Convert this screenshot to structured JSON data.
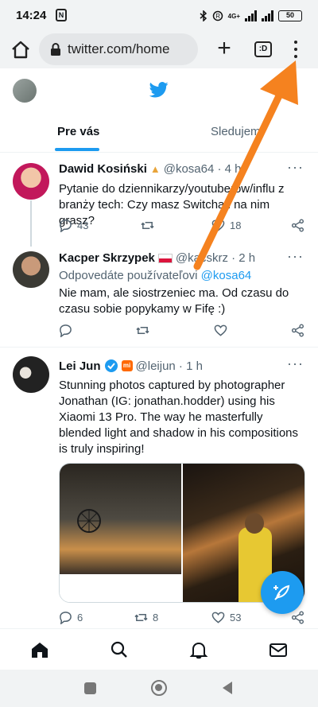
{
  "status_bar": {
    "time": "14:24",
    "network": "4G+",
    "battery": "50"
  },
  "browser": {
    "url": "twitter.com/home",
    "tab_badge": ":D"
  },
  "twitter": {
    "tabs": [
      {
        "label": "Pre vás"
      },
      {
        "label": "Sledujem"
      }
    ],
    "accent_color": "#1d9bf0"
  },
  "tweets": [
    {
      "name": "Dawid Kosiński",
      "handle": "@kosa64 · 4 h",
      "text": "Pytanie do dziennikarzy/youtuberów/influ z branży tech: Czy masz Switcha i na nim grasz?",
      "replies": "43",
      "retweets": "",
      "likes": "18"
    },
    {
      "name": "Kacper Skrzypek",
      "handle": "@kacskrz · 2 h",
      "reply_prefix": "Odpovedáte používateľovi",
      "reply_mention": "@kosa64",
      "text": "Nie mam, ale siostrzeniec ma. Od czasu do czasu sobie popykamy w Fifę :)",
      "replies": "",
      "retweets": "",
      "likes": ""
    },
    {
      "name": "Lei Jun",
      "handle": "@leijun · 1 h",
      "text": "Stunning photos captured by photographer Jonathan (IG: jonathan.hodder) using his Xiaomi 13 Pro. The way he masterfully blended light and shadow in his compositions is truly inspiring!",
      "replies": "6",
      "retweets": "8",
      "likes": "53"
    }
  ],
  "annotation": {
    "arrow_color": "#f5821f"
  }
}
